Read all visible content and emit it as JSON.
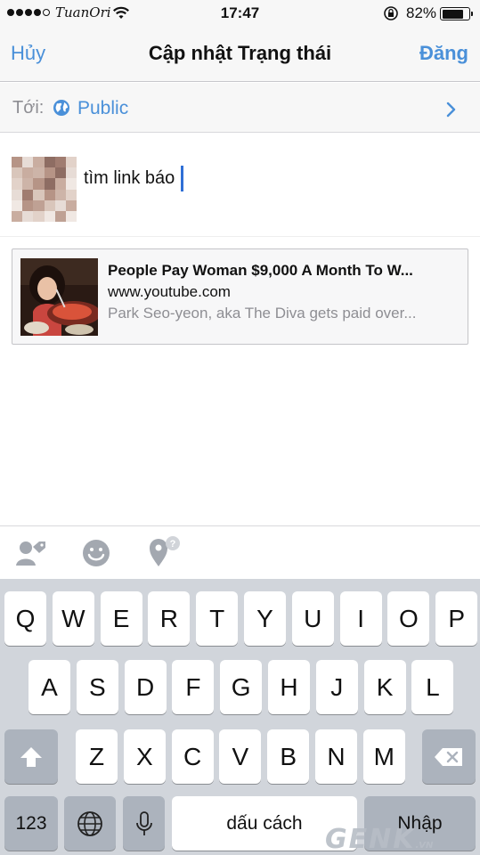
{
  "status_bar": {
    "carrier": "TuanOri",
    "time": "17:47",
    "battery": "82%",
    "battery_level": 0.82
  },
  "nav": {
    "cancel": "Hủy",
    "title": "Cập nhật Trạng thái",
    "post": "Đăng"
  },
  "audience": {
    "label": "Tới:",
    "value": "Public",
    "icon": "globe-icon"
  },
  "composer": {
    "text": "tìm link báo"
  },
  "link_preview": {
    "title": "People Pay Woman $9,000 A Month To W...",
    "domain": "www.youtube.com",
    "description": "Park Seo-yeon, aka The Diva gets paid over..."
  },
  "attachments": [
    "tag-people-icon",
    "feeling-icon",
    "check-in-icon"
  ],
  "keyboard": {
    "row1": [
      "Q",
      "W",
      "E",
      "R",
      "T",
      "Y",
      "U",
      "I",
      "O",
      "P"
    ],
    "row2": [
      "A",
      "S",
      "D",
      "F",
      "G",
      "H",
      "J",
      "K",
      "L"
    ],
    "row3": [
      "Z",
      "X",
      "C",
      "V",
      "B",
      "N",
      "M"
    ],
    "numbers": "123",
    "space": "dấu cách",
    "return": "Nhập"
  },
  "watermark": {
    "brand": "GENK",
    "suffix": ".VN"
  },
  "colors": {
    "accent": "#4a90d9",
    "keyboard_bg": "#d1d5db",
    "function_key": "#acb3bd"
  }
}
